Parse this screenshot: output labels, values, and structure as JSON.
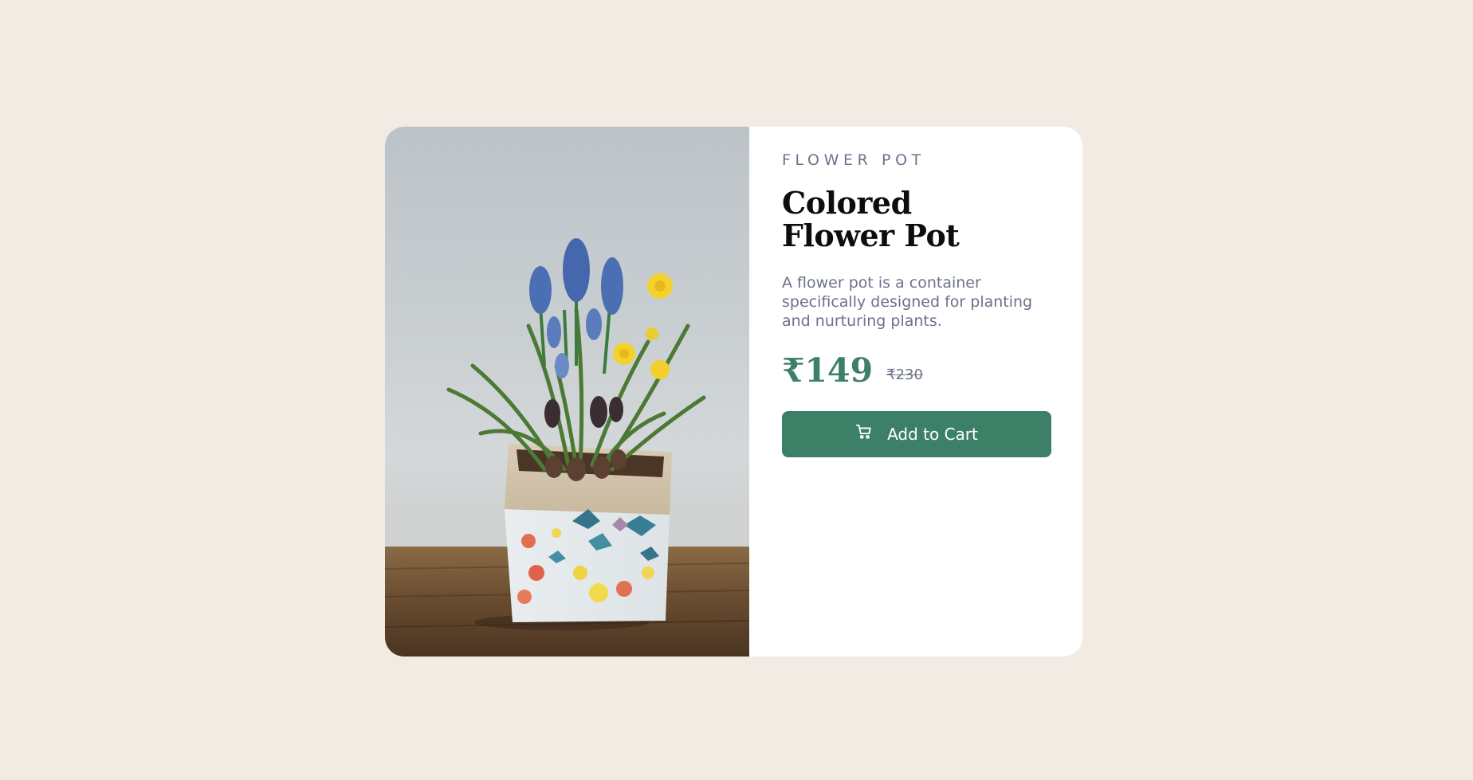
{
  "product": {
    "image_alt": "Colored flower pot with blue grape hyacinths and yellow daffodils",
    "category": "FLOWER POT",
    "title": "Colored Flower Pot",
    "description": "A flower pot is a container specifically designed for planting and nurturing plants.",
    "price_current": "₹149",
    "price_original": "₹230",
    "cta": {
      "label": "Add to Cart",
      "icon": "cart-icon"
    }
  },
  "colors": {
    "page_background": "#f2ebe4",
    "card_background": "#ffffff",
    "accent": "#3c8067",
    "muted_text": "#6c7289",
    "heading_text": "#0d0d0d"
  }
}
